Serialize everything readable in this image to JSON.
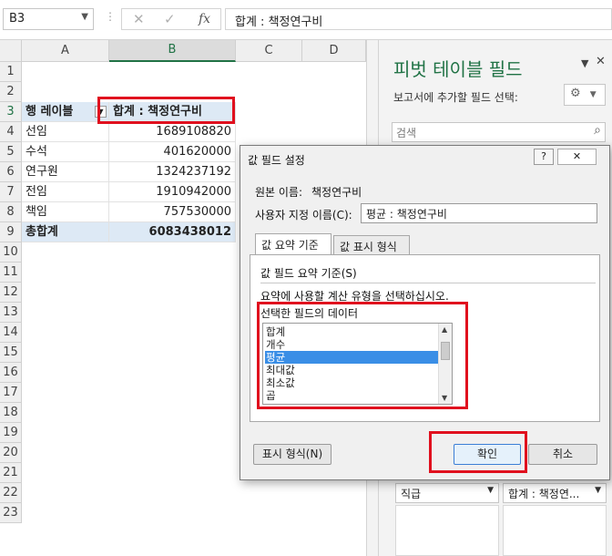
{
  "formula_bar": {
    "name_box": "B3",
    "cancel_icon": "✕",
    "enter_icon": "✓",
    "fx_label": "fx",
    "formula": "합계 : 책정연구비"
  },
  "sheet": {
    "columns": [
      "A",
      "B",
      "C",
      "D"
    ],
    "rows": [
      "1",
      "2",
      "3",
      "4",
      "5",
      "6",
      "7",
      "8",
      "9",
      "10",
      "11",
      "12",
      "13",
      "14",
      "15",
      "16",
      "17",
      "18",
      "19",
      "20",
      "21",
      "22",
      "23"
    ],
    "header": {
      "row_label": "행 레이블",
      "value_label": "합계 : 책정연구비"
    },
    "data": [
      {
        "label": "선임",
        "value": "1689108820"
      },
      {
        "label": "수석",
        "value": "401620000"
      },
      {
        "label": "연구원",
        "value": "1324237192"
      },
      {
        "label": "전임",
        "value": "1910942000"
      },
      {
        "label": "책임",
        "value": "757530000"
      }
    ],
    "total": {
      "label": "총합계",
      "value": "6083438012"
    }
  },
  "pivot_pane": {
    "title": "피벗 테이블 필드",
    "subtitle": "보고서에 추가할 필드 선택:",
    "search_placeholder": "검색",
    "row_chip": "직급",
    "value_chip": "합계 : 책정연..."
  },
  "dialog": {
    "title": "값 필드 설정",
    "help": "?",
    "close": "✕",
    "source_label": "원본 이름:",
    "source_value": "책정연구비",
    "custom_label": "사용자 지정 이름(C):",
    "custom_value": "평균 : 책정연구비",
    "tabs": [
      "값 요약 기준",
      "값 표시 형식"
    ],
    "summarize_label": "값 필드 요약 기준(S)",
    "instruction": "요약에 사용할 계산 유형을 선택하십시오.",
    "list_label": "선택한 필드의 데이터",
    "options": [
      "합계",
      "개수",
      "평균",
      "최대값",
      "최소값",
      "곱"
    ],
    "selected_option": "평균",
    "format_button": "표시 형식(N)",
    "ok_button": "확인",
    "cancel_button": "취소"
  },
  "colors": {
    "accent": "#217346",
    "highlight": "#e0101e",
    "selection": "#3a8ee6"
  }
}
